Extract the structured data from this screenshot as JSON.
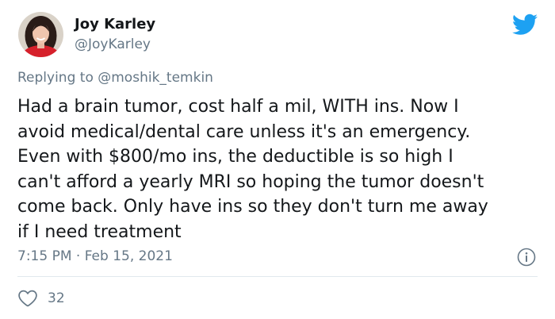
{
  "author": {
    "display_name": "Joy Karley",
    "handle": "@JoyKarley"
  },
  "reply": {
    "prefix": "Replying to",
    "mention": "@moshik_temkin"
  },
  "tweet": {
    "lines": [
      "Had a brain tumor, cost half a mil, WITH ins. Now I",
      "avoid medical/dental care unless it's an emergency.",
      "Even with $800/mo ins, the deductible is so high I",
      "can't afford a yearly MRI so hoping the tumor doesn't",
      "come back. Only have ins so they don't turn me away",
      "if I need treatment"
    ]
  },
  "meta": {
    "timestamp": "7:15 PM · Feb 15, 2021"
  },
  "actions": {
    "like_count": "32"
  },
  "icons": {
    "logo": "twitter-bird-icon",
    "info": "info-icon",
    "like": "heart-icon"
  },
  "colors": {
    "brand": "#1da1f2",
    "text_primary": "#14171a",
    "text_secondary": "#657786",
    "divider": "#e1e8ed"
  }
}
